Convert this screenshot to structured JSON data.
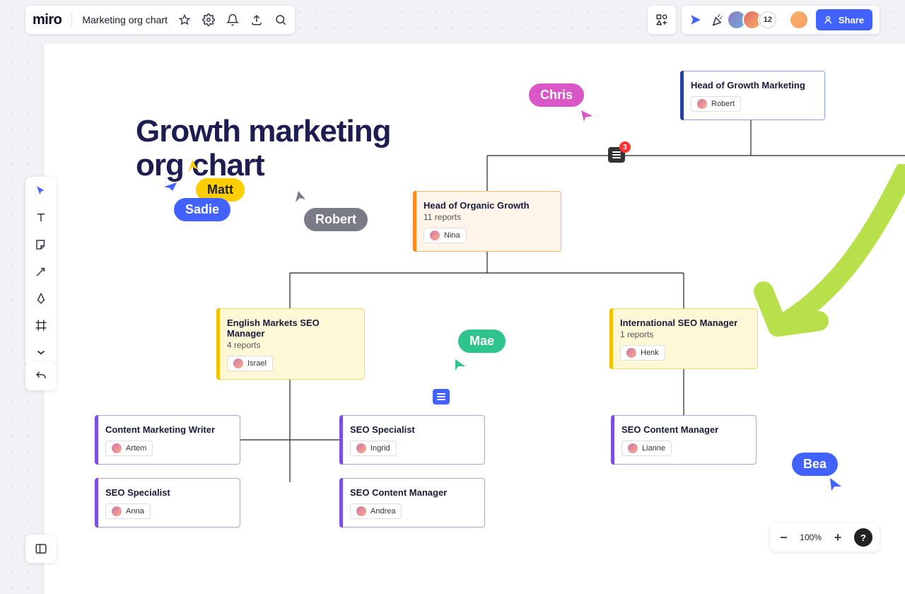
{
  "app": {
    "logo": "miro",
    "board_name": "Marketing org chart"
  },
  "toolbar_right": {
    "avatar_overflow": "12",
    "share_label": "Share"
  },
  "title": "Growth marketing\norg chart",
  "cards": {
    "head_growth": {
      "title": "Head of Growth Marketing",
      "person": "Robert"
    },
    "head_organic": {
      "title": "Head of Organic Growth",
      "subtitle": "11 reports",
      "person": "Nina"
    },
    "eng_seo_mgr": {
      "title": "English Markets SEO Manager",
      "subtitle": "4 reports",
      "person": "Israel"
    },
    "intl_seo_mgr": {
      "title": "International SEO Manager",
      "subtitle": "1 reports",
      "person": "Henk"
    },
    "content_writer": {
      "title": "Content Marketing Writer",
      "person": "Artem"
    },
    "seo_spec_1": {
      "title": "SEO Specialist",
      "person": "Ingrid"
    },
    "seo_content_mgr_intl": {
      "title": "SEO Content Manager",
      "person": "Lianne"
    },
    "seo_spec_2": {
      "title": "SEO Specialist",
      "person": "Anna"
    },
    "seo_content_mgr_2": {
      "title": "SEO Content Manager",
      "person": "Andrea"
    }
  },
  "cursors": {
    "chris": "Chris",
    "sadie": "Sadie",
    "matt": "Matt",
    "robert": "Robert",
    "mae": "Mae",
    "bea": "Bea"
  },
  "comment_badge": "3",
  "zoom": {
    "level": "100%"
  }
}
